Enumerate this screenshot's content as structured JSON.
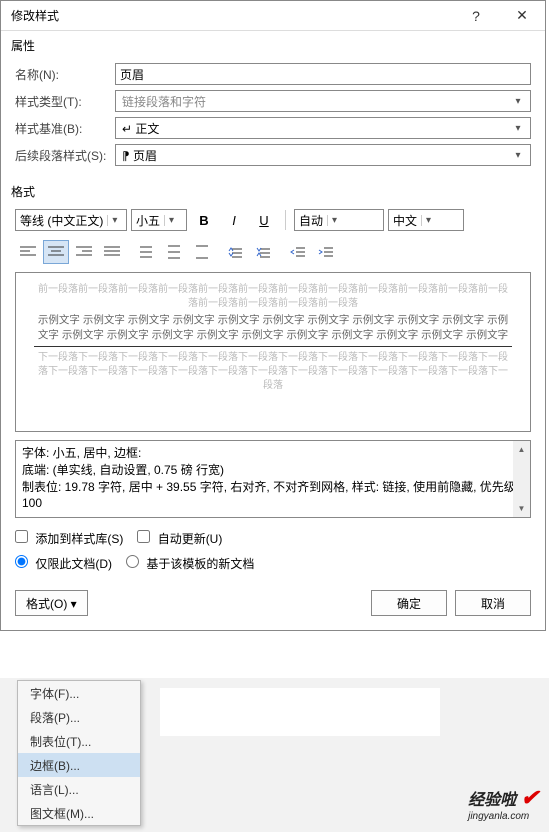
{
  "title": "修改样式",
  "section_props": "属性",
  "labels": {
    "name": "名称(N):",
    "styleType": "样式类型(T):",
    "basedOn": "样式基准(B):",
    "followStyle": "后续段落样式(S):"
  },
  "fields": {
    "name": "页眉",
    "styleType": "链接段落和字符",
    "basedOn": "↵ 正文",
    "followStyle": "⁋ 页眉"
  },
  "section_format": "格式",
  "toolbar": {
    "font": "等线 (中文正文)",
    "size": "小五",
    "colorLabel": "自动",
    "langLabel": "中文"
  },
  "preview": {
    "prev": "前一段落前一段落前一段落前一段落前一段落前一段落前一段落前一段落前一段落前一段落前一段落前一段落前一段落前一段落前一段落前一段落",
    "sample": "示例文字 示例文字 示例文字 示例文字 示例文字 示例文字 示例文字 示例文字 示例文字 示例文字 示例文字 示例文字 示例文字 示例文字 示例文字 示例文字 示例文字 示例文字 示例文字 示例文字 示例文字",
    "next": "下一段落下一段落下一段落下一段落下一段落下一段落下一段落下一段落下一段落下一段落下一段落下一段落下一段落下一段落下一段落下一段落下一段落下一段落下一段落下一段落下一段落下一段落下一段落下一段落"
  },
  "desc": {
    "l1": "字体: 小五, 居中, 边框:",
    "l2": "    底端: (单实线, 自动设置,  0.75 磅 行宽)",
    "l3": "    制表位:  19.78 字符, 居中 +  39.55 字符, 右对齐, 不对齐到网格, 样式: 链接, 使用前隐藏, 优先级: 100"
  },
  "checks": {
    "addGallery": "添加到样式库(S)",
    "autoUpdate": "自动更新(U)"
  },
  "radios": {
    "thisDoc": "仅限此文档(D)",
    "template": "基于该模板的新文档"
  },
  "buttons": {
    "format": "格式(O) ▾",
    "ok": "确定",
    "cancel": "取消"
  },
  "menu": {
    "font": "字体(F)...",
    "para": "段落(P)...",
    "tabs": "制表位(T)...",
    "border": "边框(B)...",
    "lang": "语言(L)...",
    "frame": "图文框(M)..."
  },
  "watermark": {
    "main": "经验啦",
    "sub": "jingyanla.com"
  }
}
